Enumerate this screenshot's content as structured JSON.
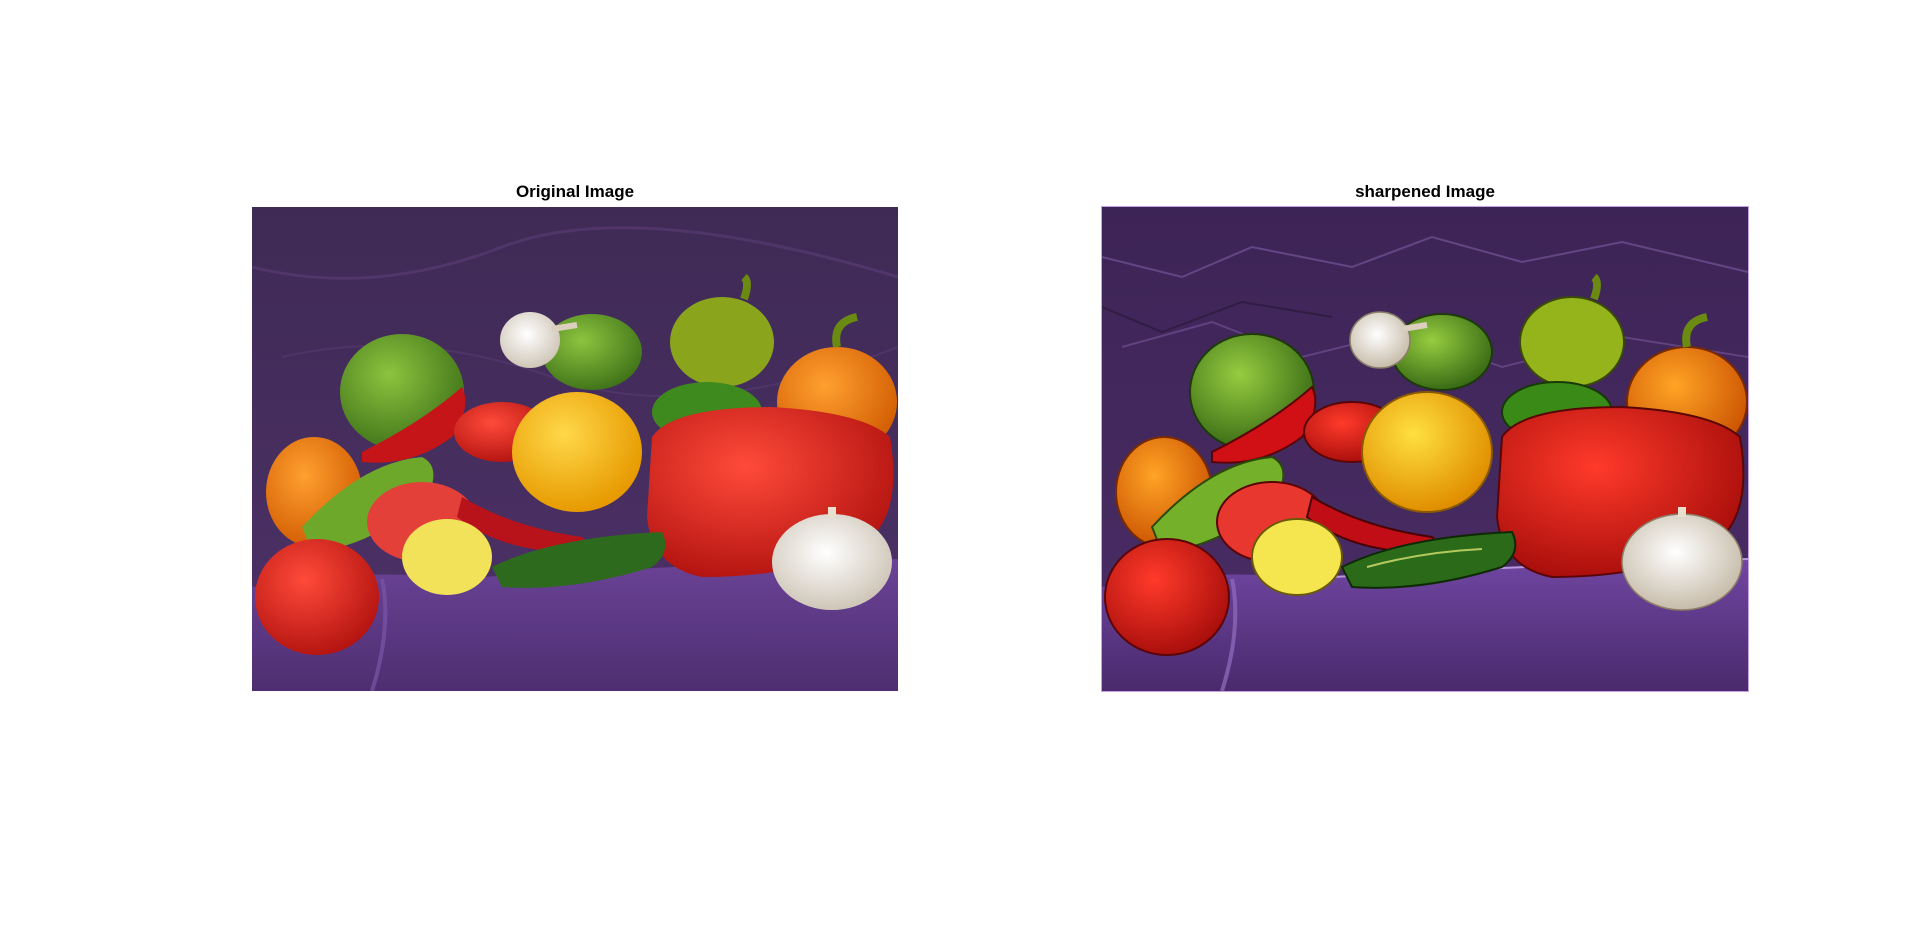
{
  "figure": {
    "panels": [
      {
        "title": "Original Image",
        "image_icon": "peppers-photo",
        "variant": "original"
      },
      {
        "title": "sharpened Image",
        "image_icon": "peppers-photo",
        "variant": "sharpened"
      }
    ]
  },
  "colors": {
    "background_cloth": "#4b2f66",
    "cloth_light": "#6a4596",
    "green_pepper": "#5f9a2a",
    "red_pepper": "#d0201f",
    "orange_pepper": "#f07a10",
    "yellow_pepper": "#f5b400",
    "garlic": "#ece6dc"
  }
}
